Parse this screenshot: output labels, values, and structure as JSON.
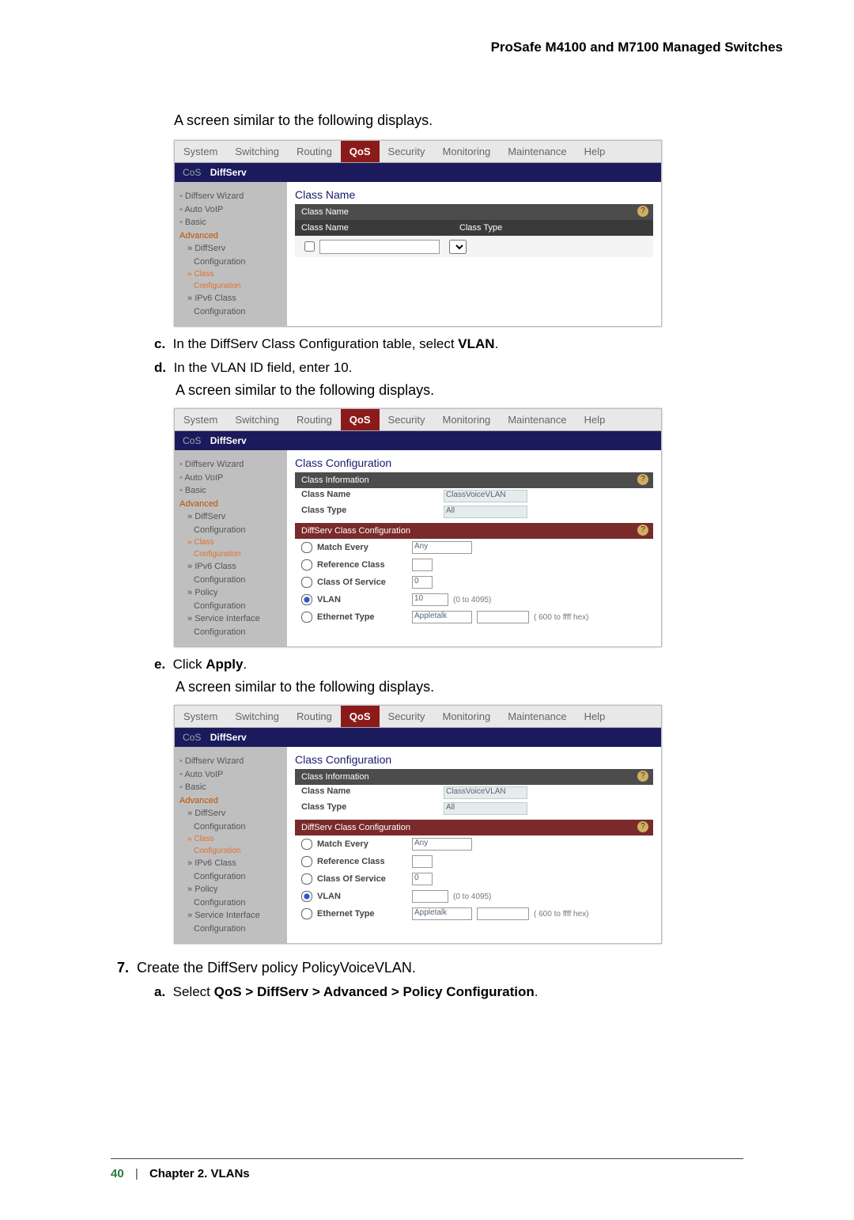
{
  "header_right": "ProSafe M4100 and M7100 Managed Switches",
  "intro1": "A screen similar to the following displays.",
  "tabs": {
    "system": "System",
    "switching": "Switching",
    "routing": "Routing",
    "qos": "QoS",
    "security": "Security",
    "monitoring": "Monitoring",
    "maintenance": "Maintenance",
    "help": "Help"
  },
  "subtab": {
    "cos": "CoS",
    "diffserv": "DiffServ"
  },
  "screen1": {
    "title": "Class Name",
    "bar_title": "Class Name",
    "col1": "Class Name",
    "col2": "Class Type",
    "side": {
      "wiz": "Diffserv Wizard",
      "voip": "Auto VoIP",
      "basic": "Basic",
      "adv": "Advanced",
      "diff": "DiffServ",
      "cfg": "Configuration",
      "class": "Class",
      "classcfg": "Configuration",
      "ipv6": "IPv6 Class",
      "ipv6cfg": "Configuration"
    }
  },
  "step_c_marker": "c.",
  "step_c_text": "In the DiffServ Class Configuration table, select ",
  "step_c_bold": "VLAN",
  "step_c_end": ".",
  "step_d_marker": "d.",
  "step_d_text": "In the VLAN ID field, enter 10.",
  "intro2": "A screen similar to the following displays.",
  "screen2": {
    "title": "Class Configuration",
    "bar1": "Class Information",
    "bar2": "DiffServ Class Configuration",
    "info": {
      "name_l": "Class Name",
      "name_v": "ClassVoiceVLAN",
      "type_l": "Class Type",
      "type_v": "All"
    },
    "rows": {
      "match": "Match Every",
      "match_v": "Any",
      "ref": "Reference Class",
      "ref_v": "",
      "cos": "Class Of Service",
      "cos_v": "0",
      "vlan": "VLAN",
      "vlan_v": "10",
      "vlan_h": "(0 to 4095)",
      "eth": "Ethernet Type",
      "eth_v": "Appletalk",
      "eth_h": "( 600 to ffff hex)"
    },
    "side": {
      "wiz": "Diffserv Wizard",
      "voip": "Auto VoIP",
      "basic": "Basic",
      "adv": "Advanced",
      "diff": "DiffServ",
      "cfg": "Configuration",
      "class": "Class",
      "classcfg": "Configuration",
      "ipv6": "IPv6 Class",
      "ipv6cfg": "Configuration",
      "pol": "Policy",
      "polcfg": "Configuration",
      "svc": "Service Interface",
      "svccfg": "Configuration"
    }
  },
  "step_e_marker": "e.",
  "step_e_text1": "Click ",
  "step_e_bold": "Apply",
  "step_e_end": ".",
  "intro3": "A screen similar to the following displays.",
  "screen3": {
    "title": "Class Configuration",
    "bar1": "Class Information",
    "bar2": "DiffServ Class Configuration",
    "info": {
      "name_l": "Class Name",
      "name_v": "ClassVoiceVLAN",
      "type_l": "Class Type",
      "type_v": "All"
    },
    "rows": {
      "match": "Match Every",
      "match_v": "Any",
      "ref": "Reference Class",
      "ref_v": "",
      "cos": "Class Of Service",
      "cos_v": "0",
      "vlan": "VLAN",
      "vlan_v": "",
      "vlan_h": "(0 to 4095)",
      "eth": "Ethernet Type",
      "eth_v": "Appletalk",
      "eth_h": "( 600 to ffff hex)"
    },
    "side": {
      "wiz": "Diffserv Wizard",
      "voip": "Auto VoIP",
      "basic": "Basic",
      "adv": "Advanced",
      "diff": "DiffServ",
      "cfg": "Configuration",
      "class": "Class",
      "classcfg": "Configuration",
      "ipv6": "IPv6 Class",
      "ipv6cfg": "Configuration",
      "pol": "Policy",
      "polcfg": "Configuration",
      "svc": "Service Interface",
      "svccfg": "Configuration"
    }
  },
  "step7_marker": "7.",
  "step7_text": "Create the DiffServ policy PolicyVoiceVLAN.",
  "step7a_marker": "a.",
  "step7a_text": "Select ",
  "step7a_bold": "QoS > DiffServ > Advanced > Policy Configuration",
  "step7a_end": ".",
  "footer": {
    "page": "40",
    "sep": "|",
    "chapter": "Chapter 2.  VLANs"
  }
}
